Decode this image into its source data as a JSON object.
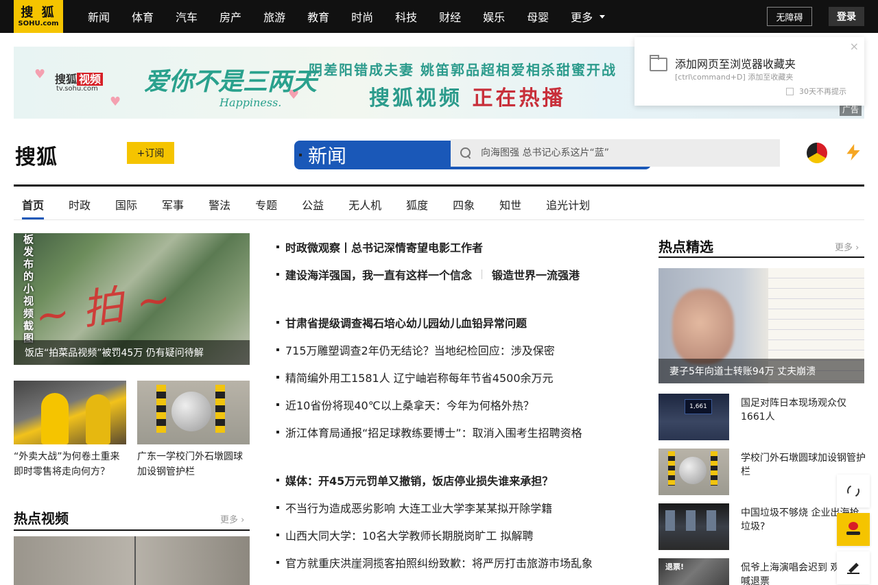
{
  "topbar": {
    "logo_top": "搜 狐",
    "logo_bottom": "SOHU.com",
    "nav": [
      "新闻",
      "体育",
      "汽车",
      "房产",
      "旅游",
      "教育",
      "时尚",
      "科技",
      "财经",
      "娱乐",
      "母婴"
    ],
    "more_label": "更多",
    "accessibility_label": "无障碍",
    "login_label": "登录"
  },
  "banner": {
    "brand_a": "搜狐",
    "brand_b": "视频",
    "site": "tv.sohu.com",
    "slogan": "爱你不是三两天",
    "happy": "Happiness.",
    "line1": "阴差阳错成夫妻 姚笛郭品超相爱相杀甜蜜开战",
    "line2_a": "搜狐视频",
    "line2_b": "正在热播",
    "ad_tag": "广告"
  },
  "bookmark_popup": {
    "title": "添加网页至浏览器收藏夹",
    "subtitle": "[ctrl\\command+D] 添加至收藏夹",
    "close": "×",
    "dont_remind": "30天不再提示"
  },
  "channel": {
    "logo_a": "搜狐",
    "logo_b": "新闻",
    "subscribe_label": "+订阅",
    "search_placeholder": "向海图强 总书记心系这片“蓝”"
  },
  "section_nav": [
    "首页",
    "时政",
    "国际",
    "军事",
    "警法",
    "专题",
    "公益",
    "无人机",
    "狐度",
    "四象",
    "知世",
    "追光计划"
  ],
  "left": {
    "hero_vertical": "板发布的小视频截图",
    "hero_caption": "饭店“拍菜品视频”被罚45万 仍有疑问待解",
    "thumbs": [
      {
        "caption": "“外卖大战”为何卷土重来 即时零售将走向何方？"
      },
      {
        "caption": "广东一学校门外石墩圆球加设钢管护栏"
      }
    ],
    "hot_video_title": "热点视频",
    "more_label": "更多 ›"
  },
  "middle": {
    "news": [
      {
        "text": "时政微观察丨总书记深情寄望电影工作者",
        "bold": true
      },
      {
        "text": "建设海洋强国，我一直有这样一个信念",
        "text2": "锻造世界一流强港",
        "bold": true
      },
      {
        "text": "甘肃省提级调查褐石培心幼儿园幼儿血铅异常问题",
        "bold": true
      },
      {
        "text": "715万雕塑调查2年仍无结论？当地纪检回应：涉及保密",
        "bold": false
      },
      {
        "text": "精简编外用工1581人 辽宁岫岩称每年节省4500余万元",
        "bold": false
      },
      {
        "text": "近10省份将现40℃以上桑拿天：今年为何格外热？",
        "bold": false
      },
      {
        "text": "浙江体育局通报“招足球教练要博士”：取消入围考生招聘资格",
        "bold": false
      },
      {
        "text": "媒体：开45万元罚单又撤销，饭店停业损失谁来承担？",
        "bold": true
      },
      {
        "text": "不当行为造成恶劣影响 大连工业大学李某某拟开除学籍",
        "bold": false
      },
      {
        "text": "山西大同大学：10名大学教师长期脱岗旷工 拟解聘",
        "bold": false
      },
      {
        "text": "官方就重庆洪崖洞揽客拍照纠纷致歉：将严厉打击旅游市场乱象",
        "bold": false
      }
    ]
  },
  "right": {
    "title": "热点精选",
    "more_label": "更多 ›",
    "hero_caption": "妻子5年向道士转账94万 丈夫崩溃",
    "items": [
      {
        "text": "国足对阵日本现场观众仅1661人",
        "scoreboard": "1,661"
      },
      {
        "text": "学校门外石墩圆球加设钢管护栏"
      },
      {
        "text": "中国垃圾不够烧 企业出海抢垃圾?"
      },
      {
        "text": "侃爷上海演唱会迟到 观众中喊退票",
        "overlay": "退票!"
      }
    ]
  },
  "colors": {
    "brand_yellow": "#f5c400",
    "brand_blue": "#1a58b8",
    "topbar": "#111111"
  },
  "icons": [
    "search-icon",
    "folder-icon",
    "close-icon",
    "refresh-icon",
    "fox-icon",
    "edit-icon",
    "chevron-down-icon"
  ]
}
